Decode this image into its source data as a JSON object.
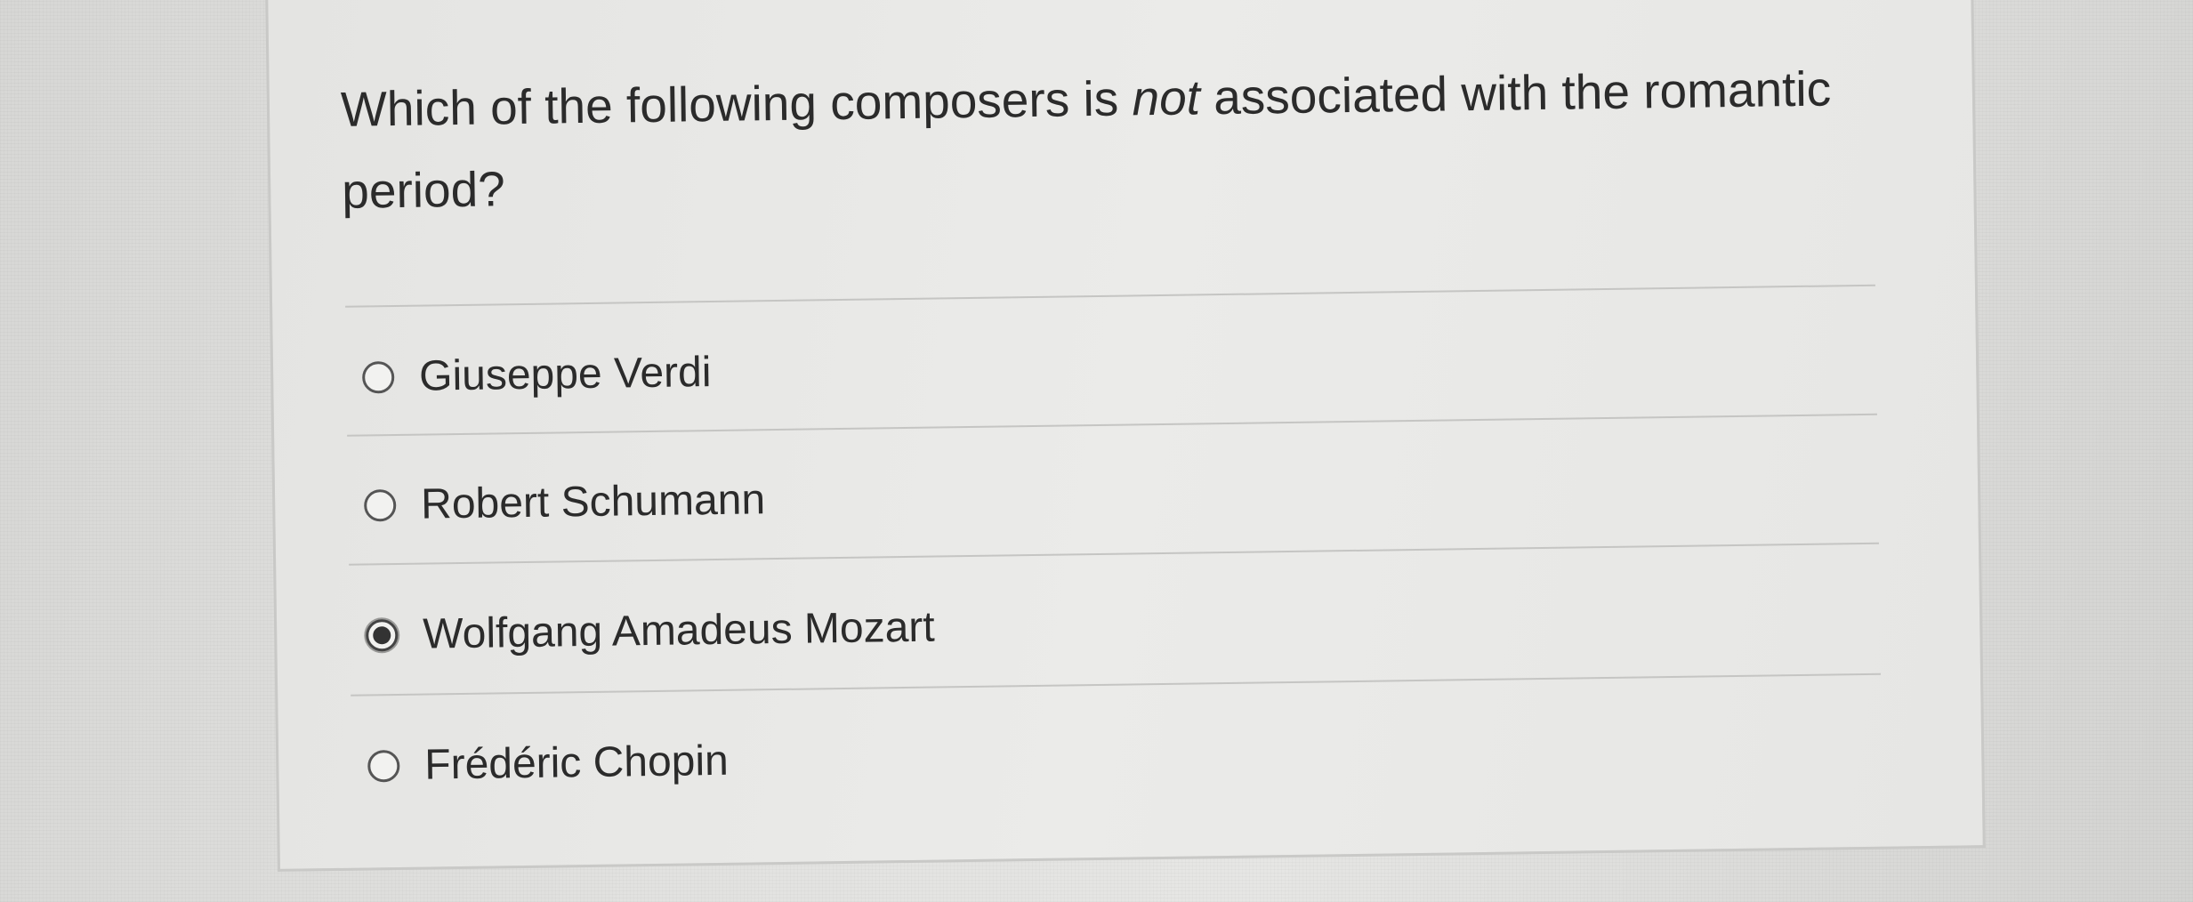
{
  "question": {
    "text_before": "Which of the following composers is ",
    "text_emphasis": "not",
    "text_after": " associated with the romantic period?"
  },
  "options": [
    {
      "label": "Giuseppe Verdi",
      "selected": false
    },
    {
      "label": "Robert Schumann",
      "selected": false
    },
    {
      "label": "Wolfgang Amadeus Mozart",
      "selected": true
    },
    {
      "label": "Frédéric Chopin",
      "selected": false
    }
  ]
}
